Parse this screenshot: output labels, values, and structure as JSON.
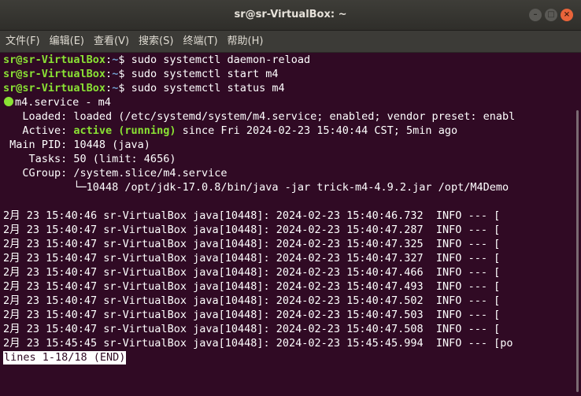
{
  "window": {
    "title": "sr@sr-VirtualBox: ~",
    "buttons": {
      "minimize": "–",
      "maximize": "□",
      "close": "×"
    }
  },
  "menu": {
    "items": [
      "文件(F)",
      "编辑(E)",
      "查看(V)",
      "搜索(S)",
      "终端(T)",
      "帮助(H)"
    ]
  },
  "prompt": {
    "user_host": "sr@sr-VirtualBox",
    "sep": ":",
    "path": "~",
    "symbol": "$ "
  },
  "commands": [
    "sudo systemctl daemon-reload",
    "sudo systemctl start m4",
    "sudo systemctl status m4"
  ],
  "status": {
    "service_line": "m4.service - m4",
    "loaded_label": "   Loaded: ",
    "loaded_value": "loaded (/etc/systemd/system/m4.service; enabled; vendor preset: enabl",
    "active_label": "   Active: ",
    "active_value": "active (running)",
    "active_rest": " since Fri 2024-02-23 15:40:44 CST; 5min ago",
    "mainpid": " Main PID: 10448 (java)",
    "tasks": "    Tasks: 50 (limit: 4656)",
    "cgroup": "   CGroup: /system.slice/m4.service",
    "cgroup_child": "           └─10448 /opt/jdk-17.0.8/bin/java -jar trick-m4-4.9.2.jar /opt/M4Demo"
  },
  "log_lines": [
    "2月 23 15:40:46 sr-VirtualBox java[10448]: 2024-02-23 15:40:46.732  INFO --- [",
    "2月 23 15:40:47 sr-VirtualBox java[10448]: 2024-02-23 15:40:47.287  INFO --- [",
    "2月 23 15:40:47 sr-VirtualBox java[10448]: 2024-02-23 15:40:47.325  INFO --- [",
    "2月 23 15:40:47 sr-VirtualBox java[10448]: 2024-02-23 15:40:47.327  INFO --- [",
    "2月 23 15:40:47 sr-VirtualBox java[10448]: 2024-02-23 15:40:47.466  INFO --- [",
    "2月 23 15:40:47 sr-VirtualBox java[10448]: 2024-02-23 15:40:47.493  INFO --- [",
    "2月 23 15:40:47 sr-VirtualBox java[10448]: 2024-02-23 15:40:47.502  INFO --- [",
    "2月 23 15:40:47 sr-VirtualBox java[10448]: 2024-02-23 15:40:47.503  INFO --- [",
    "2月 23 15:40:47 sr-VirtualBox java[10448]: 2024-02-23 15:40:47.508  INFO --- [",
    "2月 23 15:45:45 sr-VirtualBox java[10448]: 2024-02-23 15:45:45.994  INFO --- [po"
  ],
  "pager_status": "lines 1-18/18 (END)",
  "colors": {
    "background": "#300a24",
    "prompt_user": "#8ae234",
    "prompt_path": "#729fcf",
    "status_active": "#8ae234",
    "close_button": "#e9643a"
  }
}
